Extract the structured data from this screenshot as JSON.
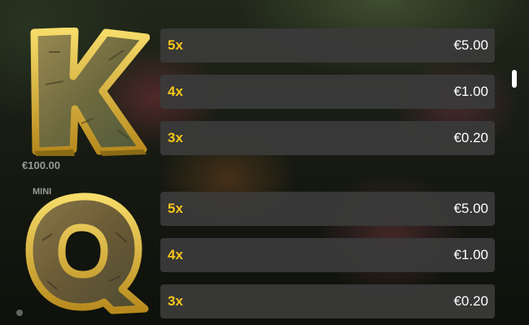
{
  "background": {
    "jackpot_value": "€100.00",
    "mini_label": "MINI"
  },
  "symbols": [
    {
      "letter": "K",
      "icon": "k-card-symbol-icon",
      "payouts": [
        {
          "multiplier": "5x",
          "prize": "€5.00"
        },
        {
          "multiplier": "4x",
          "prize": "€1.00"
        },
        {
          "multiplier": "3x",
          "prize": "€0.20"
        }
      ]
    },
    {
      "letter": "Q",
      "icon": "q-card-symbol-icon",
      "payouts": [
        {
          "multiplier": "5x",
          "prize": "€5.00"
        },
        {
          "multiplier": "4x",
          "prize": "€1.00"
        },
        {
          "multiplier": "3x",
          "prize": "€0.20"
        }
      ]
    }
  ],
  "colors": {
    "multiplier": "#f5c518",
    "prize": "#ffffff",
    "row_background": "#3a3a3a",
    "gold_frame": "#e2b72f",
    "wood": "#7a6a3c"
  }
}
